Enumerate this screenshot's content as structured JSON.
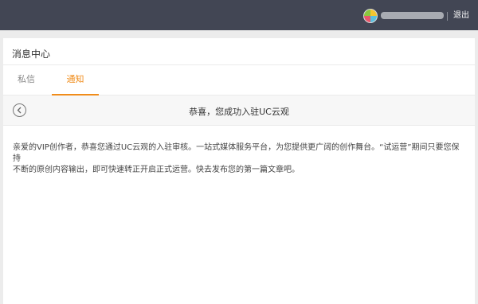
{
  "header": {
    "logout_label": "退出"
  },
  "panel": {
    "title": "消息中心"
  },
  "tabs": [
    {
      "label": "私信",
      "active": false
    },
    {
      "label": "通知",
      "active": true
    }
  ],
  "message": {
    "title": "恭喜，您成功入驻UC云观",
    "body_line1": "亲爱的VIP创作者，恭喜您通过UC云观的入驻审核。一站式媒体服务平台，为您提供更广阔的创作舞台。“试运营”期间只要您保持",
    "body_line2": "不断的原创内容输出，即可快速转正开启正式运营。快去发布您的第一篇文章吧。"
  },
  "colors": {
    "topbar": "#424654",
    "accent": "#f08c1a"
  },
  "icons": {
    "back": "chevron-left-circle-icon",
    "avatar": "avatar"
  }
}
